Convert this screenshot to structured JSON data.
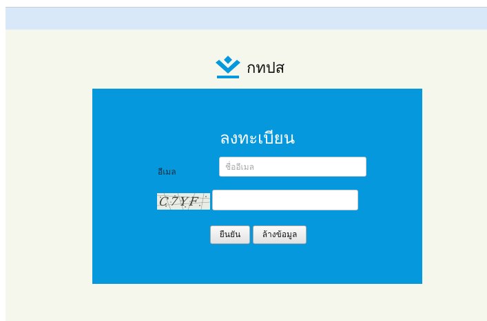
{
  "logo": {
    "text": "กทปส",
    "icon": "chevron-stack-logo-icon",
    "color": "#0598dd"
  },
  "form": {
    "title": "ลงทะเบียน",
    "email_label": "อีเมล",
    "email_placeholder": "ชื่ออีเมล",
    "email_value": "",
    "captcha_text": "C7YF",
    "captcha_value": "",
    "confirm_label": "ยืนยัน",
    "clear_label": "ล้างข้อมูล"
  },
  "colors": {
    "panel": "#0598dd",
    "page_background": "#f5f7ec",
    "top_bar": "#d9e8f8"
  }
}
